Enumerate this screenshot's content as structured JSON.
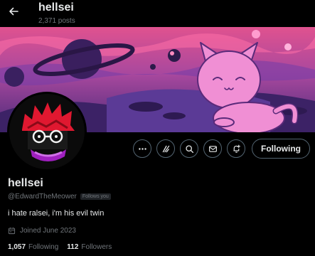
{
  "header": {
    "title": "hellsei",
    "posts_count": "2,371 posts"
  },
  "profile": {
    "display_name": "hellsei",
    "handle": "@EdwardTheMeower",
    "follows_you": "Follows you",
    "bio": "i hate ralsei, i'm his evil twin",
    "joined": "Joined June 2023"
  },
  "actions": {
    "follow_label": "Following"
  },
  "stats": {
    "following_count": "1,057",
    "following_label": "Following",
    "followers_count": "112",
    "followers_label": "Followers"
  },
  "icons": {
    "back": "arrow-left-icon",
    "more": "more-dots-icon",
    "grok": "grok-icon",
    "search": "search-icon",
    "message": "envelope-icon",
    "notify": "bell-plus-icon",
    "calendar": "calendar-icon"
  },
  "colors": {
    "background": "#000000",
    "text_primary": "#e7e9ea",
    "text_secondary": "#71767b",
    "border": "#536471",
    "banner_pink": "#e070c0",
    "banner_purple": "#5a2f88"
  }
}
